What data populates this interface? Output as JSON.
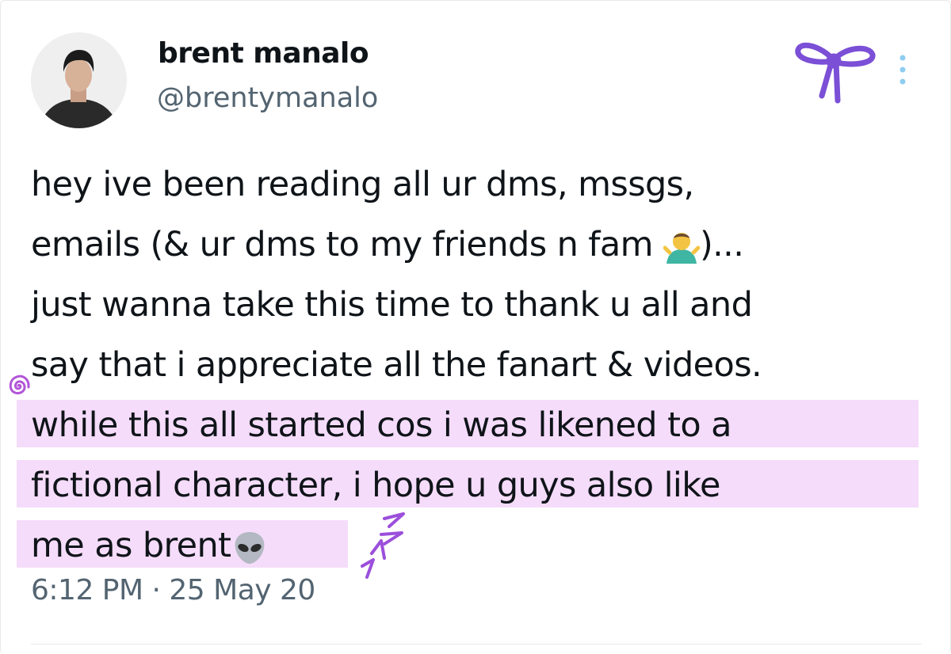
{
  "author": {
    "display_name": "brent manalo",
    "handle": "@brentymanalo"
  },
  "tweet": {
    "lines": [
      "hey ive been reading all ur dms, mssgs,",
      "emails (& ur dms to my friends n fam ",
      ")...",
      "just wanna take this time to thank u all and",
      "say that i appreciate all the fanart & videos.",
      "while this all started cos i was likened to a",
      "fictional character, i hope u guys also like",
      "me as brent"
    ],
    "emojis": [
      "person-shrugging-icon",
      "alien-icon"
    ],
    "timestamp": "6:12 PM · 25 May 20"
  },
  "colors": {
    "highlight": "#f5dcfa",
    "sticker_purple": "#7b4fd6",
    "secondary_text": "#536471"
  }
}
